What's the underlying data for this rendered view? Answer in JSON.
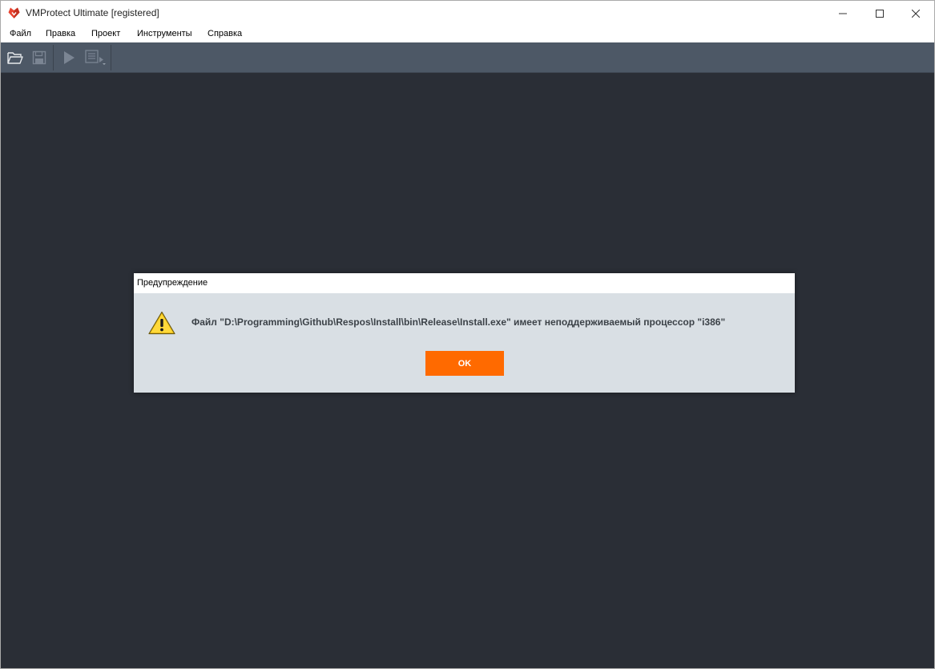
{
  "window": {
    "title": "VMProtect Ultimate [registered]",
    "controls": [
      "minimize-icon",
      "maximize-icon",
      "close-icon"
    ]
  },
  "menu": {
    "items": [
      {
        "label": "Файл"
      },
      {
        "label": "Правка"
      },
      {
        "label": "Проект"
      },
      {
        "label": "Инструменты"
      },
      {
        "label": "Справка"
      }
    ]
  },
  "toolbar": {
    "buttons": [
      {
        "icon": "open-folder-icon",
        "enabled": true
      },
      {
        "icon": "save-icon",
        "enabled": false
      },
      {
        "icon": "play-icon",
        "enabled": false
      },
      {
        "icon": "compile-options-icon",
        "enabled": false
      }
    ]
  },
  "dialog": {
    "title": "Предупреждение",
    "icon": "warning-icon",
    "message": "Файл \"D:\\Programming\\Github\\Respos\\Install\\bin\\Release\\Install.exe\" имеет неподдерживаемый процессор \"i386\"",
    "ok_label": "OK"
  },
  "colors": {
    "workspace": "#2a2e36",
    "toolbar": "#4d5866",
    "dialog_body": "#d9dfe4",
    "accent_button": "#ff6a00",
    "brand": "#e8432f"
  }
}
